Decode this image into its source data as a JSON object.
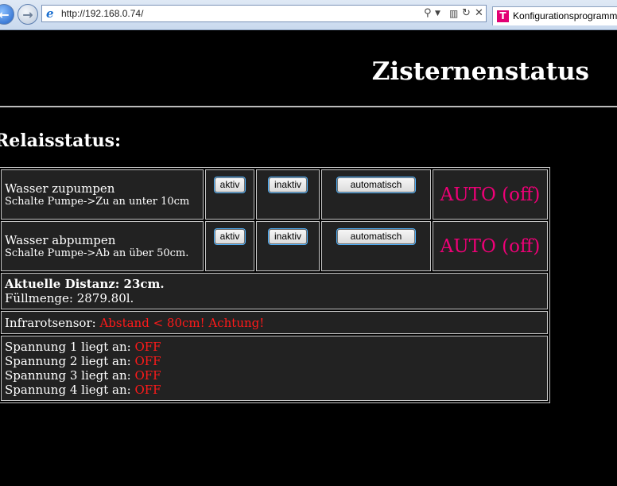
{
  "browser": {
    "url": "http://192.168.0.74/",
    "tab_title": "Konfigurationsprogramm",
    "back_glyph": "←",
    "forward_glyph": "→"
  },
  "page": {
    "title": "Zisternenstatus",
    "section_title": "Relaisstatus:"
  },
  "relays": [
    {
      "name": "Wasser zupumpen",
      "description": "Schalte Pumpe->Zu an unter 10cm",
      "btn_active": "aktiv",
      "btn_inactive": "inaktiv",
      "btn_auto": "automatisch",
      "mode": "AUTO (off)"
    },
    {
      "name": "Wasser abpumpen",
      "description": "Schalte Pumpe->Ab an über 50cm.",
      "btn_active": "aktiv",
      "btn_inactive": "inaktiv",
      "btn_auto": "automatisch",
      "mode": "AUTO (off)"
    }
  ],
  "distance": {
    "label": "Aktuelle Distanz: 23cm.",
    "fill": "Füllmenge: 2879.80l."
  },
  "infrared": {
    "label": "Infrarotsensor: ",
    "value": "Abstand < 80cm! Achtung!"
  },
  "voltages": [
    {
      "label": "Spannung 1 liegt an: ",
      "value": "OFF"
    },
    {
      "label": "Spannung 2 liegt an: ",
      "value": "OFF"
    },
    {
      "label": "Spannung 3 liegt an: ",
      "value": "OFF"
    },
    {
      "label": "Spannung 4 liegt an: ",
      "value": "OFF"
    }
  ],
  "colors": {
    "background": "#000000",
    "cell": "#222222",
    "mode_text": "#ef0077",
    "alert_text": "#ff1a1a"
  }
}
